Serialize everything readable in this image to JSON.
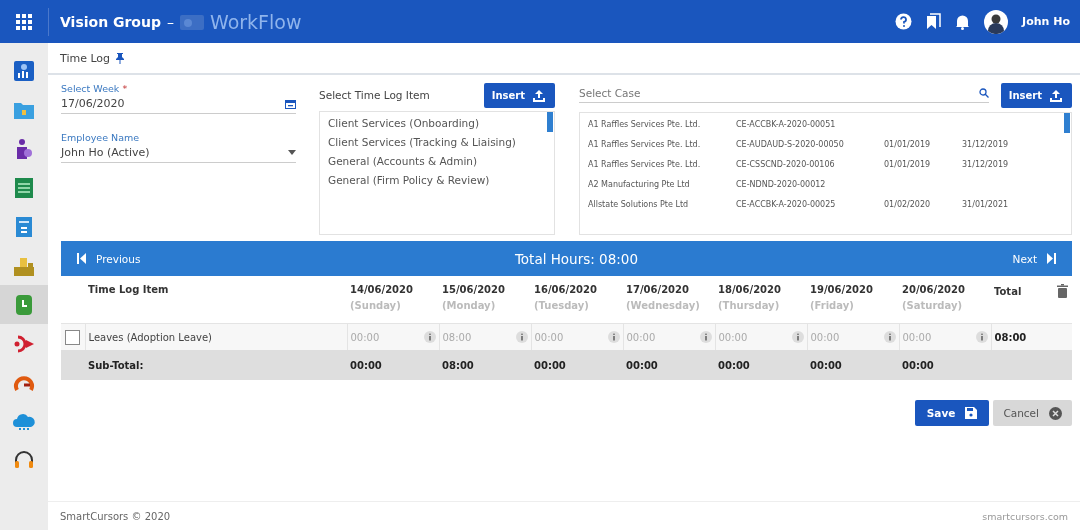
{
  "header": {
    "title": "Vision Group",
    "separator": "–",
    "product": "WorkFlow",
    "user": "John Ho"
  },
  "sidebar": {
    "items": [
      {
        "selected": false
      },
      {
        "selected": false
      },
      {
        "selected": false
      },
      {
        "selected": false
      },
      {
        "selected": false
      },
      {
        "selected": false
      },
      {
        "selected": true
      },
      {
        "selected": false
      },
      {
        "selected": false
      },
      {
        "selected": false
      },
      {
        "selected": false
      }
    ]
  },
  "page_title": "Time Log",
  "select_week": {
    "label": "Select Week",
    "required_mark": "*",
    "value": "17/06/2020"
  },
  "employee": {
    "label": "Employee Name",
    "value": "John Ho (Active)"
  },
  "time_log_items": {
    "label": "Select Time Log Item",
    "insert": "Insert",
    "items": [
      "Client Services (Onboarding)",
      "Client Services (Tracking & Liaising)",
      "General (Accounts & Admin)",
      "General (Firm Policy & Review)"
    ]
  },
  "cases": {
    "placeholder": "Select Case",
    "insert": "Insert",
    "rows": [
      {
        "company": "A1 Raffles Services Pte. Ltd.",
        "code": "CE-ACCBK-A-2020-00051"
      },
      {
        "company": "A1 Raffles Services Pte. Ltd.",
        "code": "CE-AUDAUD-S-2020-00050",
        "start": "01/01/2019",
        "end": "31/12/2019"
      },
      {
        "company": "A1 Raffles Services Pte. Ltd.",
        "code": "CE-CSSCND-2020-00106",
        "start": "01/01/2019",
        "end": "31/12/2019"
      },
      {
        "company": "A2 Manufacturing Pte Ltd",
        "code": "CE-NDND-2020-00012"
      },
      {
        "company": "Allstate Solutions Pte Ltd",
        "code": "CE-ACCBK-A-2020-00025",
        "start": "01/02/2020",
        "end": "31/01/2021"
      }
    ]
  },
  "week_nav": {
    "previous": "Previous",
    "total": "Total Hours: 08:00",
    "next": "Next"
  },
  "table": {
    "item_header": "Time Log Item",
    "total_header": "Total",
    "columns": [
      {
        "date": "14/06/2020",
        "day": "(Sunday)"
      },
      {
        "date": "15/06/2020",
        "day": "(Monday)"
      },
      {
        "date": "16/06/2020",
        "day": "(Tuesday)"
      },
      {
        "date": "17/06/2020",
        "day": "(Wednesday)"
      },
      {
        "date": "18/06/2020",
        "day": "(Thursday)"
      },
      {
        "date": "19/06/2020",
        "day": "(Friday)"
      },
      {
        "date": "20/06/2020",
        "day": "(Saturday)"
      }
    ],
    "rows": [
      {
        "checked": false,
        "item": "Leaves (Adoption Leave)",
        "hours": [
          "00:00",
          "08:00",
          "00:00",
          "00:00",
          "00:00",
          "00:00",
          "00:00"
        ],
        "total": "08:00"
      }
    ],
    "subtotal": {
      "label": "Sub-Total:",
      "values": [
        "00:00",
        "08:00",
        "00:00",
        "00:00",
        "00:00",
        "00:00",
        "00:00"
      ]
    }
  },
  "buttons": {
    "save": "Save",
    "cancel": "Cancel"
  },
  "footer": {
    "copyright": "SmartCursors © 2020",
    "site": "smartcursors.com"
  }
}
